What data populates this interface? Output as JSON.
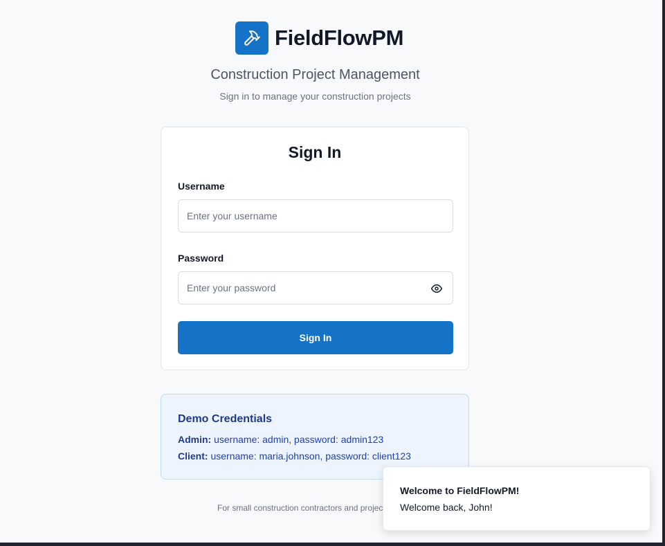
{
  "brand": {
    "icon": "hammer-icon",
    "name": "FieldFlowPM",
    "accent_color": "#1473c6"
  },
  "header": {
    "tagline": "Construction Project Management",
    "subtitle": "Sign in to manage your construction projects"
  },
  "signin": {
    "title": "Sign In",
    "username_label": "Username",
    "username_value": "",
    "username_placeholder": "Enter your username",
    "password_label": "Password",
    "password_value": "",
    "password_placeholder": "Enter your password",
    "toggle_icon": "eye-icon",
    "submit_label": "Sign In"
  },
  "demo": {
    "title": "Demo Credentials",
    "admin_role": "Admin:",
    "admin_text": "username: admin, password: admin123",
    "client_role": "Client:",
    "client_text": "username: maria.johnson, password: client123"
  },
  "footer": {
    "text": "For small construction contractors and projec"
  },
  "toast": {
    "title": "Welcome to FieldFlowPM!",
    "message": "Welcome back, John!"
  }
}
